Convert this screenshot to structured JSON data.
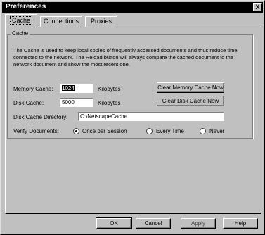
{
  "window": {
    "title": "Preferences",
    "close_glyph": "X"
  },
  "tabs": [
    {
      "label": "Cache",
      "active": true
    },
    {
      "label": "Connections",
      "active": false
    },
    {
      "label": "Proxies",
      "active": false
    }
  ],
  "cache": {
    "group_label": "Cache",
    "description": "The Cache is used to keep local copies of frequently accessed documents and thus reduce time connected to the network. The Reload button will always compare the cached document to the network document and show the most recent one.",
    "memory_cache": {
      "label": "Memory Cache:",
      "value": "1024",
      "unit": "Kilobytes"
    },
    "disk_cache": {
      "label": "Disk Cache:",
      "value": "5000",
      "unit": "Kilobytes"
    },
    "clear_memory_button": "Clear Memory Cache Now",
    "clear_disk_button": "Clear Disk Cache Now",
    "disk_cache_directory": {
      "label": "Disk Cache Directory:",
      "value": "C:\\NetscapeCache"
    },
    "verify": {
      "label": "Verify Documents:",
      "options": [
        {
          "label": "Once per Session",
          "checked": true
        },
        {
          "label": "Every Time",
          "checked": false
        },
        {
          "label": "Never",
          "checked": false
        }
      ]
    }
  },
  "buttons": {
    "ok": "OK",
    "cancel": "Cancel",
    "apply": "Apply",
    "help": "Help"
  }
}
